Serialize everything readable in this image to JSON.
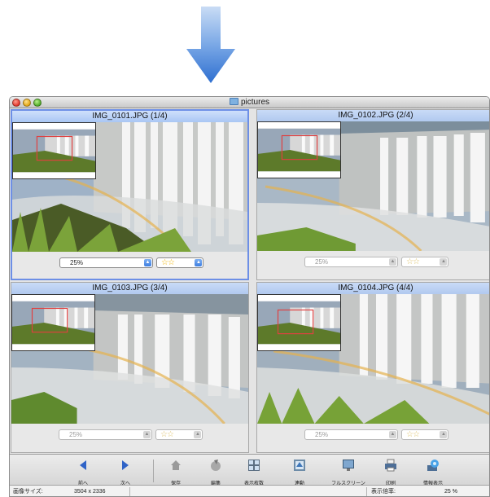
{
  "window": {
    "title": "pictures"
  },
  "panes": [
    {
      "title": "IMG_0101.JPG (1/4)",
      "zoom": "25%",
      "rating": "☆☆",
      "active": true
    },
    {
      "title": "IMG_0102.JPG (2/4)",
      "zoom": "25%",
      "rating": "☆☆",
      "active": false
    },
    {
      "title": "IMG_0103.JPG (3/4)",
      "zoom": "25%",
      "rating": "☆☆",
      "active": false
    },
    {
      "title": "IMG_0104.JPG (4/4)",
      "zoom": "25%",
      "rating": "☆☆",
      "active": false
    }
  ],
  "toolbar": {
    "prev": "前へ",
    "next": "次へ",
    "save": "保存",
    "edit": "編集",
    "display_count": "表示枚数",
    "sync": "連動",
    "fullscreen": "フルスクリーン",
    "print": "印刷",
    "info": "情報表示"
  },
  "status": {
    "size_label": "画像サイズ:",
    "size_value": "3504 x 2336",
    "zoom_label": "表示倍率:",
    "zoom_value": "25 %"
  },
  "icons": {
    "down_arrow": "down-arrow-icon",
    "prev": "left-triangle-icon",
    "next": "right-triangle-icon",
    "save": "house-save-icon",
    "edit": "pencil-edit-icon",
    "display_count": "grid-icon",
    "sync": "sync-icon",
    "fullscreen": "monitor-icon",
    "print": "printer-icon",
    "info": "info-globe-icon"
  },
  "colors": {
    "accent": "#6d8fe6",
    "pane_header": "#b6cdf5",
    "arrow": "#3f7fd6",
    "star": "#f0b400"
  }
}
